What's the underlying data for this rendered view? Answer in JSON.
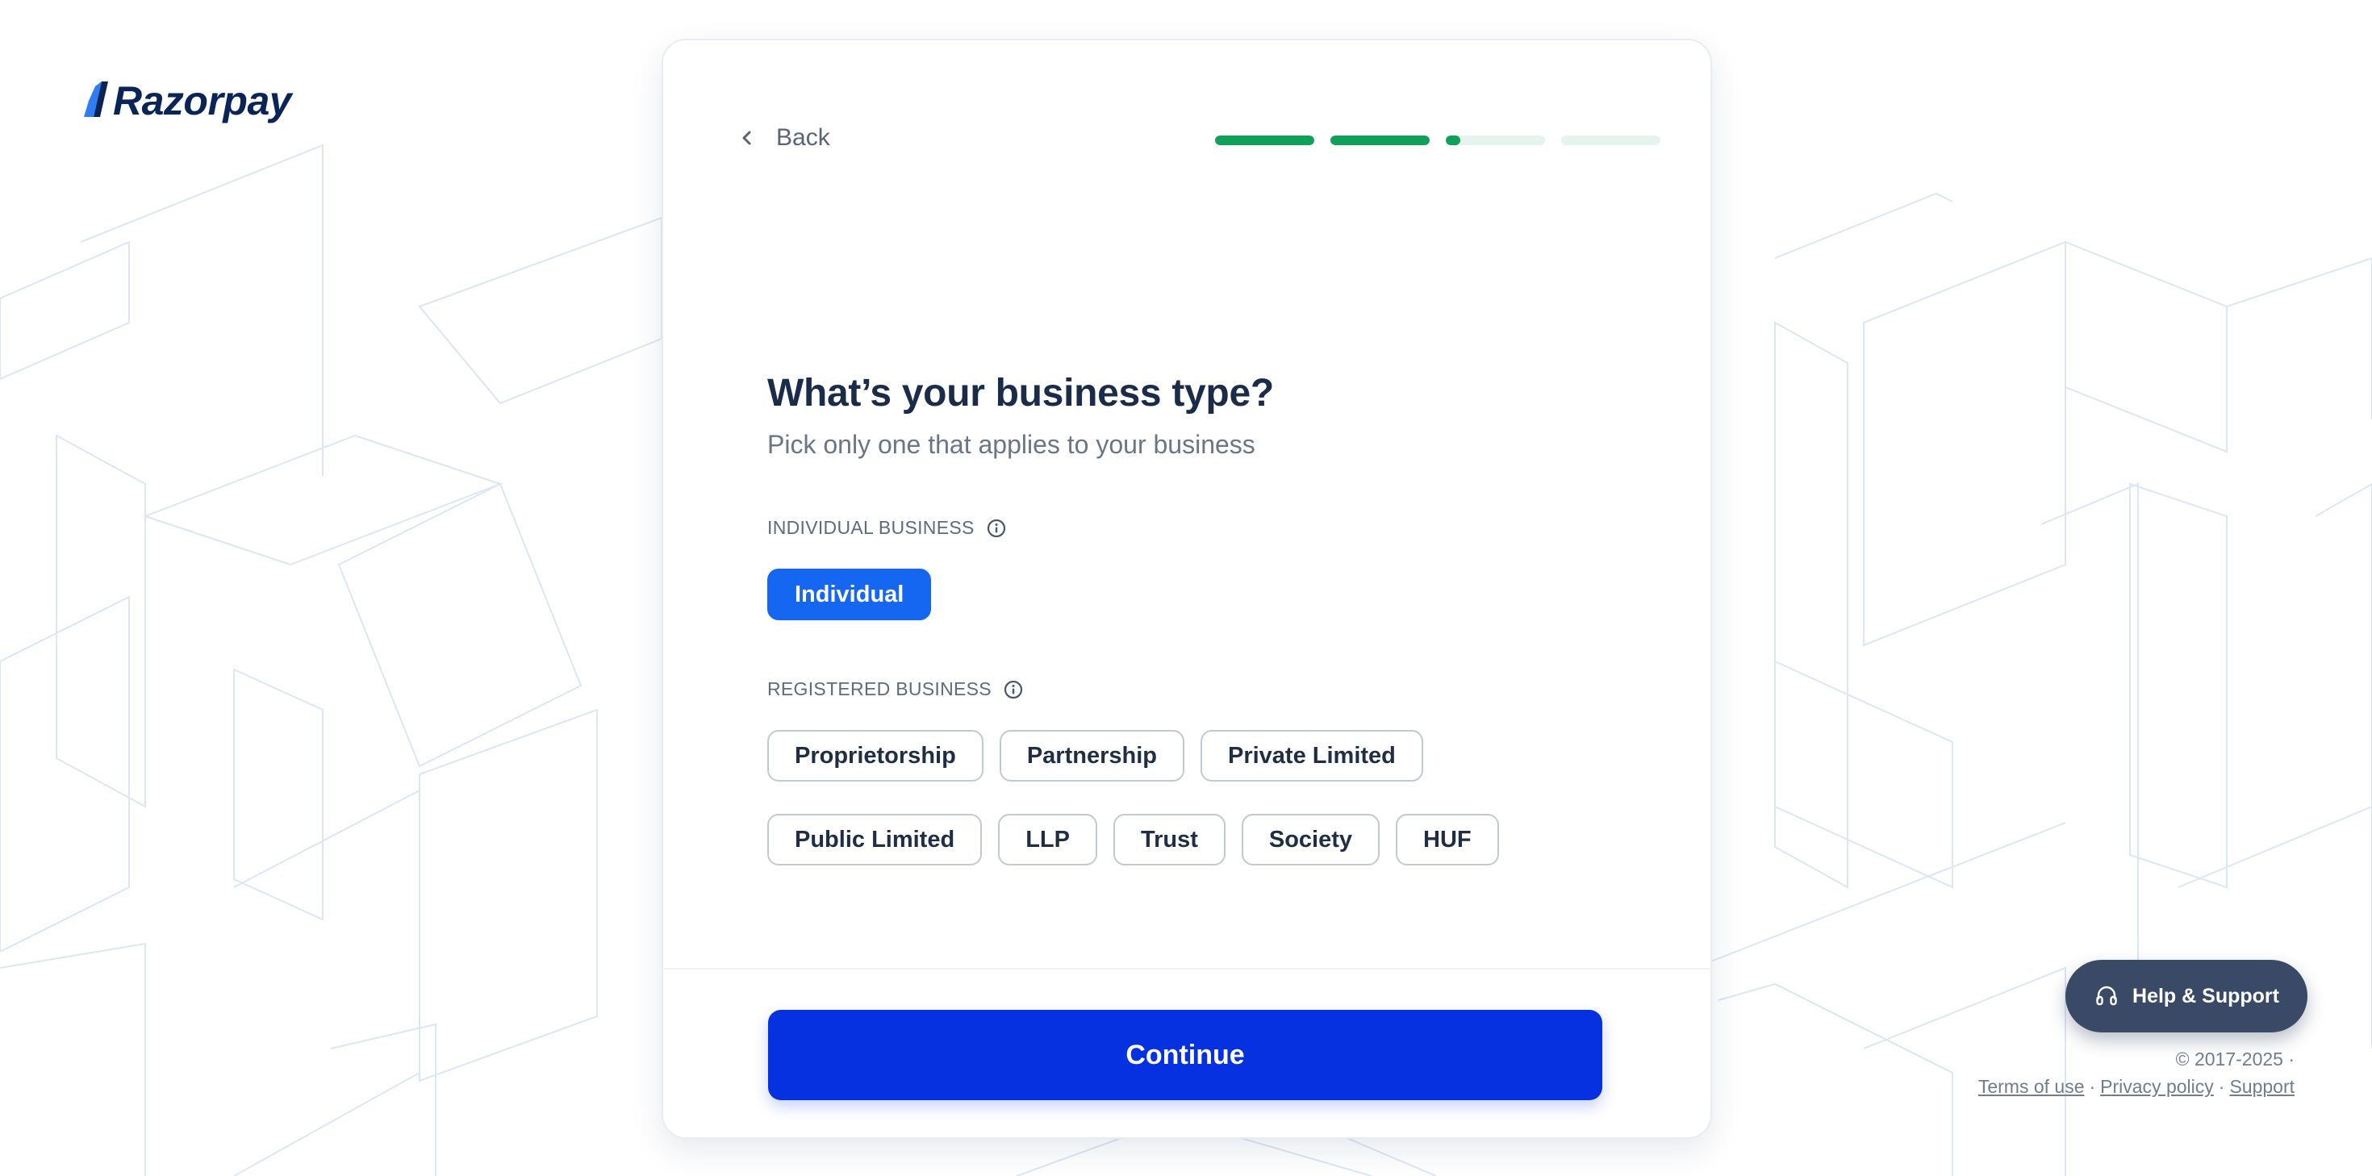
{
  "brand": {
    "name": "Razorpay",
    "color": "#0b2457",
    "accent": "#2e7cf6"
  },
  "header": {
    "back_label": "Back",
    "progress": [
      {
        "fill": 1.0
      },
      {
        "fill": 1.0
      },
      {
        "fill": 0.15
      },
      {
        "fill": 0.0
      }
    ]
  },
  "question": {
    "title": "What’s your business type?",
    "subtitle": "Pick only one that applies to your business"
  },
  "sections": {
    "individual": {
      "label": "INDIVIDUAL BUSINESS",
      "options": [
        {
          "label": "Individual",
          "selected": true
        }
      ]
    },
    "registered": {
      "label": "REGISTERED BUSINESS",
      "options_row1": [
        {
          "label": "Proprietorship"
        },
        {
          "label": "Partnership"
        },
        {
          "label": "Private Limited"
        }
      ],
      "options_row2": [
        {
          "label": "Public Limited"
        },
        {
          "label": "LLP"
        },
        {
          "label": "Trust"
        },
        {
          "label": "Society"
        },
        {
          "label": "HUF"
        }
      ]
    }
  },
  "footer": {
    "continue_label": "Continue"
  },
  "help": {
    "label": "Help & Support",
    "icon": "headphones-icon"
  },
  "legal": {
    "copyright": "© 2017-2025 ·",
    "terms": "Terms of use",
    "privacy": "Privacy policy",
    "support": "Support",
    "separator": "·"
  },
  "colors": {
    "selected_chip": "#1566f0",
    "continue_button": "#0531e0",
    "progress_active": "#11a05a",
    "progress_track": "#e5f4ec",
    "help_button": "#3a4a66"
  }
}
